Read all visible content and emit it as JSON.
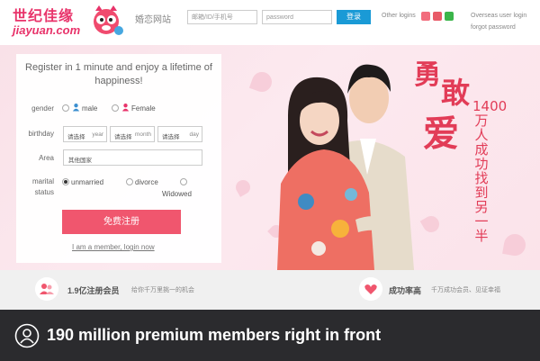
{
  "header": {
    "logo_cn": "世纪佳缘",
    "logo_en": "jiayuan.com",
    "site_label": "婚恋网站",
    "account_placeholder": "邮箱/ID/手机号",
    "password_placeholder": "password",
    "login_label": "登录",
    "other_logins_label": "Other logins",
    "overseas_label": "Overseas user login",
    "forgot_label": "forgot password",
    "social_icons": [
      "qq-icon",
      "weibo-icon",
      "wechat-icon"
    ],
    "social_colors": [
      "#f26d7d",
      "#e85a67",
      "#3bb54a"
    ]
  },
  "hero": {
    "headline_chars": [
      "勇",
      "敢",
      "爱"
    ],
    "slogan": "1400万人成功找到另一半"
  },
  "form": {
    "title": "Register in 1 minute and enjoy a lifetime of happiness!",
    "gender_label": "gender",
    "gender_options": [
      "male",
      "Female"
    ],
    "birthday_label": "birthday",
    "birthday_fields": [
      {
        "value": "请选择",
        "unit": "year"
      },
      {
        "value": "请选择",
        "unit": "month"
      },
      {
        "value": "请选择",
        "unit": "day"
      }
    ],
    "area_label": "Area",
    "area_value": "其他国家",
    "marital_label_1": "marital",
    "marital_label_2": "status",
    "marital_options": [
      "unmarried",
      "divorce",
      "Widowed"
    ],
    "marital_selected": "unmarried",
    "register_label": "免费注册",
    "member_link": "I am a member, login now"
  },
  "features": [
    {
      "title": "1.9亿注册会员",
      "desc": "给你千万里挑一的机会",
      "icon": "members-icon"
    },
    {
      "title": "成功率高",
      "desc": "千万成功会员、见证幸福",
      "icon": "heart-icon"
    }
  ],
  "caption": {
    "text": "190 million premium members right in front",
    "icon": "user-icon"
  },
  "colors": {
    "accent": "#e8336a",
    "button_pink": "#f0566e",
    "login_blue": "#1a9ad6",
    "caption_bg": "#2b2b2e"
  }
}
